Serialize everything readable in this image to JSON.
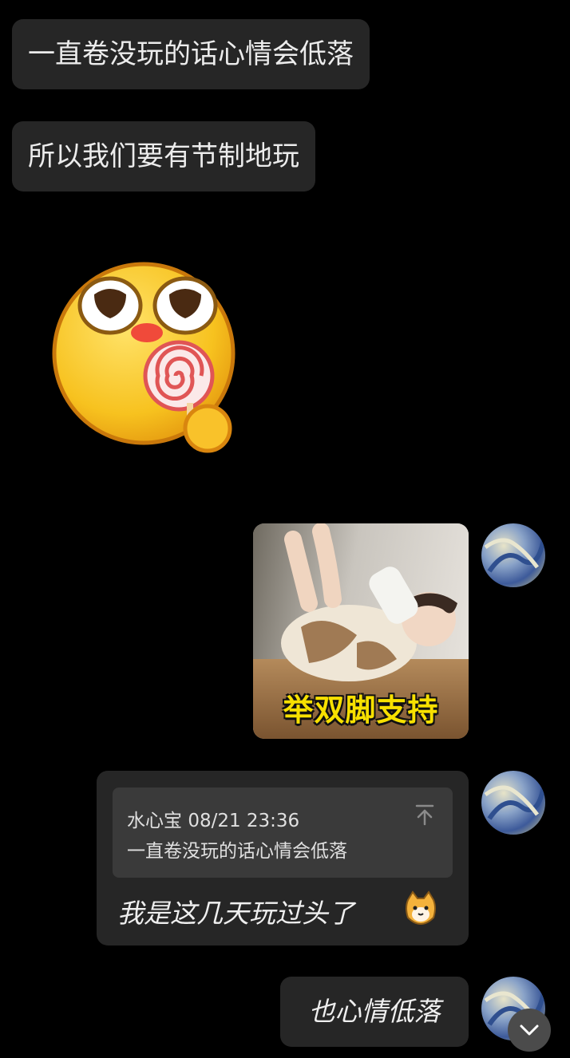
{
  "messages": [
    {
      "side": "left",
      "type": "text",
      "text": "一直卷没玩的话心情会低落"
    },
    {
      "side": "left",
      "type": "text",
      "text": "所以我们要有节制地玩"
    },
    {
      "side": "left",
      "type": "sticker",
      "icon": "lollipop-emoji-icon"
    },
    {
      "side": "right",
      "type": "image",
      "caption": "举双脚支持"
    },
    {
      "side": "right",
      "type": "reply",
      "quote": {
        "author": "水心宝",
        "time": "08/21 23:36",
        "text": "一直卷没玩的话心情会低落"
      },
      "text": "我是这几天玩过头了",
      "emoji": "cat-emoji-icon"
    },
    {
      "side": "right",
      "type": "text",
      "text": "也心情低落"
    }
  ],
  "colors": {
    "background": "#000000",
    "bubble": "#262626",
    "quote": "#3a3a3a",
    "caption": "#f7e000"
  }
}
